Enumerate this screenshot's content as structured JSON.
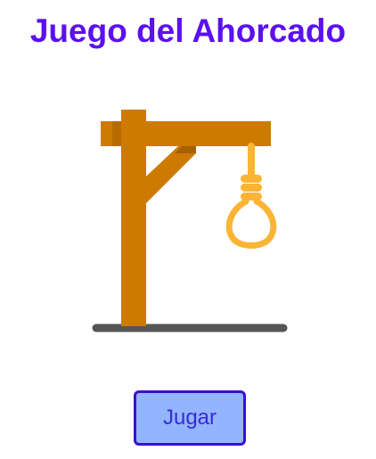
{
  "title": "Juego del Ahorcado",
  "play_button_label": "Jugar",
  "colors": {
    "title": "#5b10f0",
    "wood": "#cc7a00",
    "wood_shadow": "#a85f00",
    "rope": "#fbb434",
    "ground": "#555555",
    "button_bg": "#93b4ff",
    "button_border": "#3a10d0"
  },
  "gallows_illustration": "gallows-with-noose"
}
